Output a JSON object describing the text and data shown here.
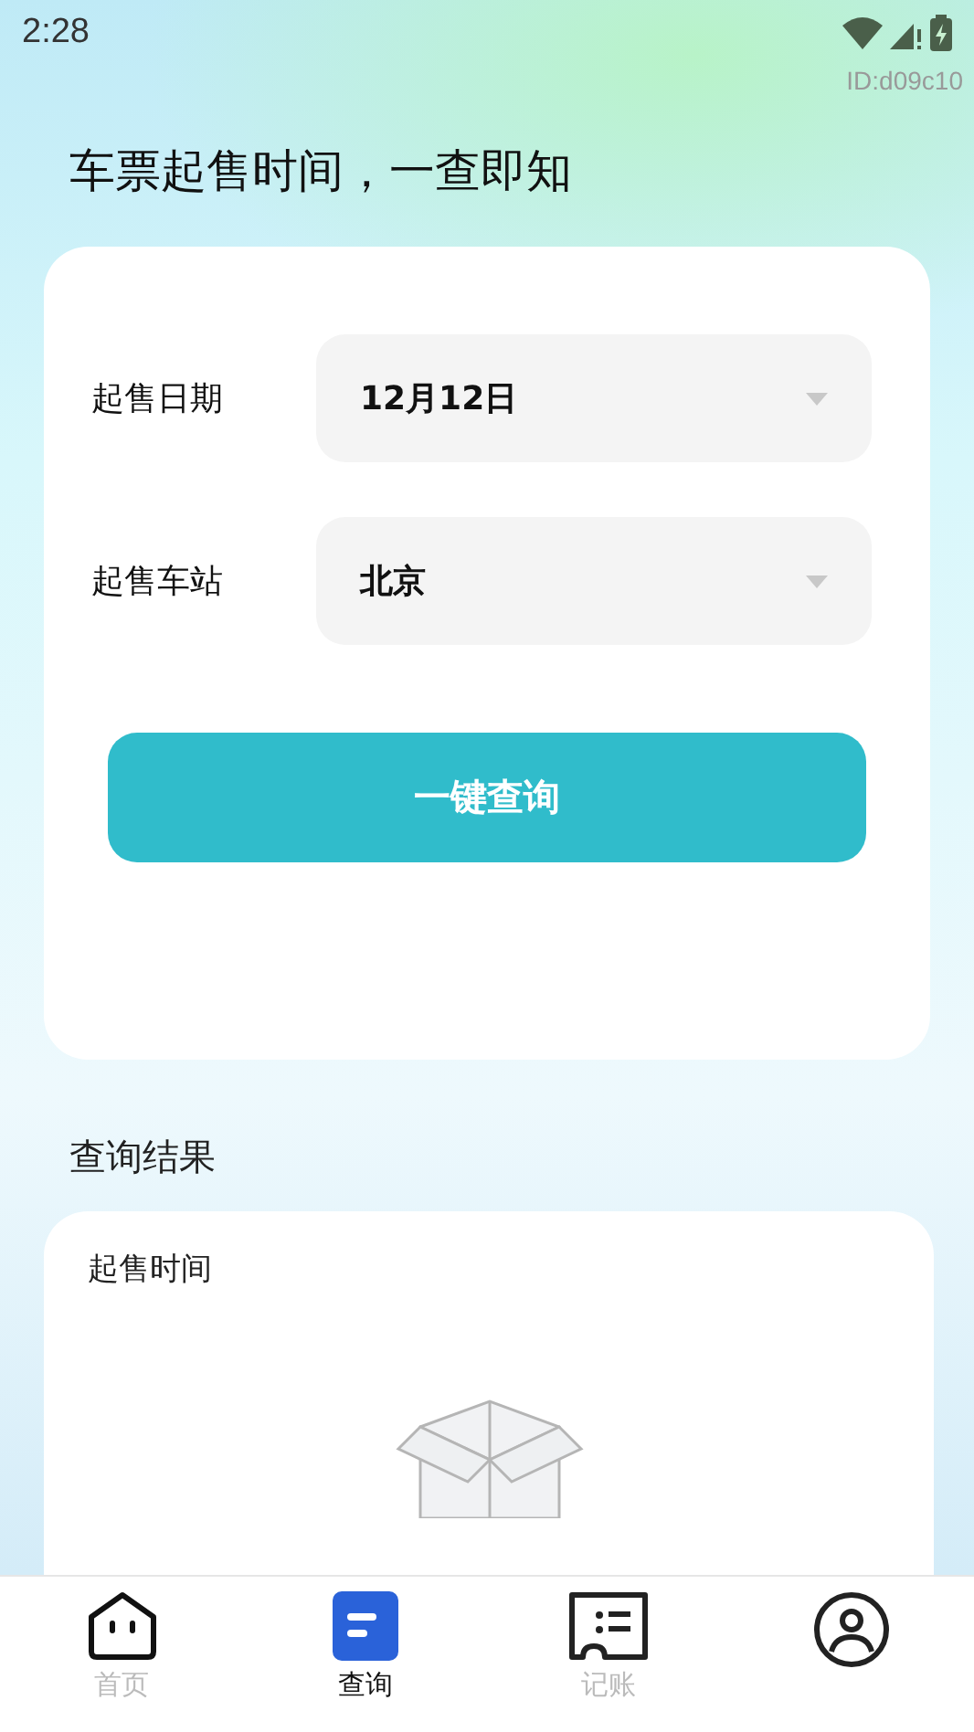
{
  "status_bar": {
    "time": "2:28"
  },
  "device_id": "ID:d09c10",
  "headline": "车票起售时间，一查即知",
  "query_form": {
    "fields": [
      {
        "label": "起售日期",
        "value": "12月12日"
      },
      {
        "label": "起售车站",
        "value": "北京"
      }
    ],
    "submit_button": "一键查询"
  },
  "results": {
    "title": "查询结果",
    "column_label": "起售时间"
  },
  "tab_bar": [
    {
      "label": "首页",
      "selected": false
    },
    {
      "label": "查询",
      "selected": true
    },
    {
      "label": "记账",
      "selected": false
    },
    {
      "selected": false
    }
  ]
}
